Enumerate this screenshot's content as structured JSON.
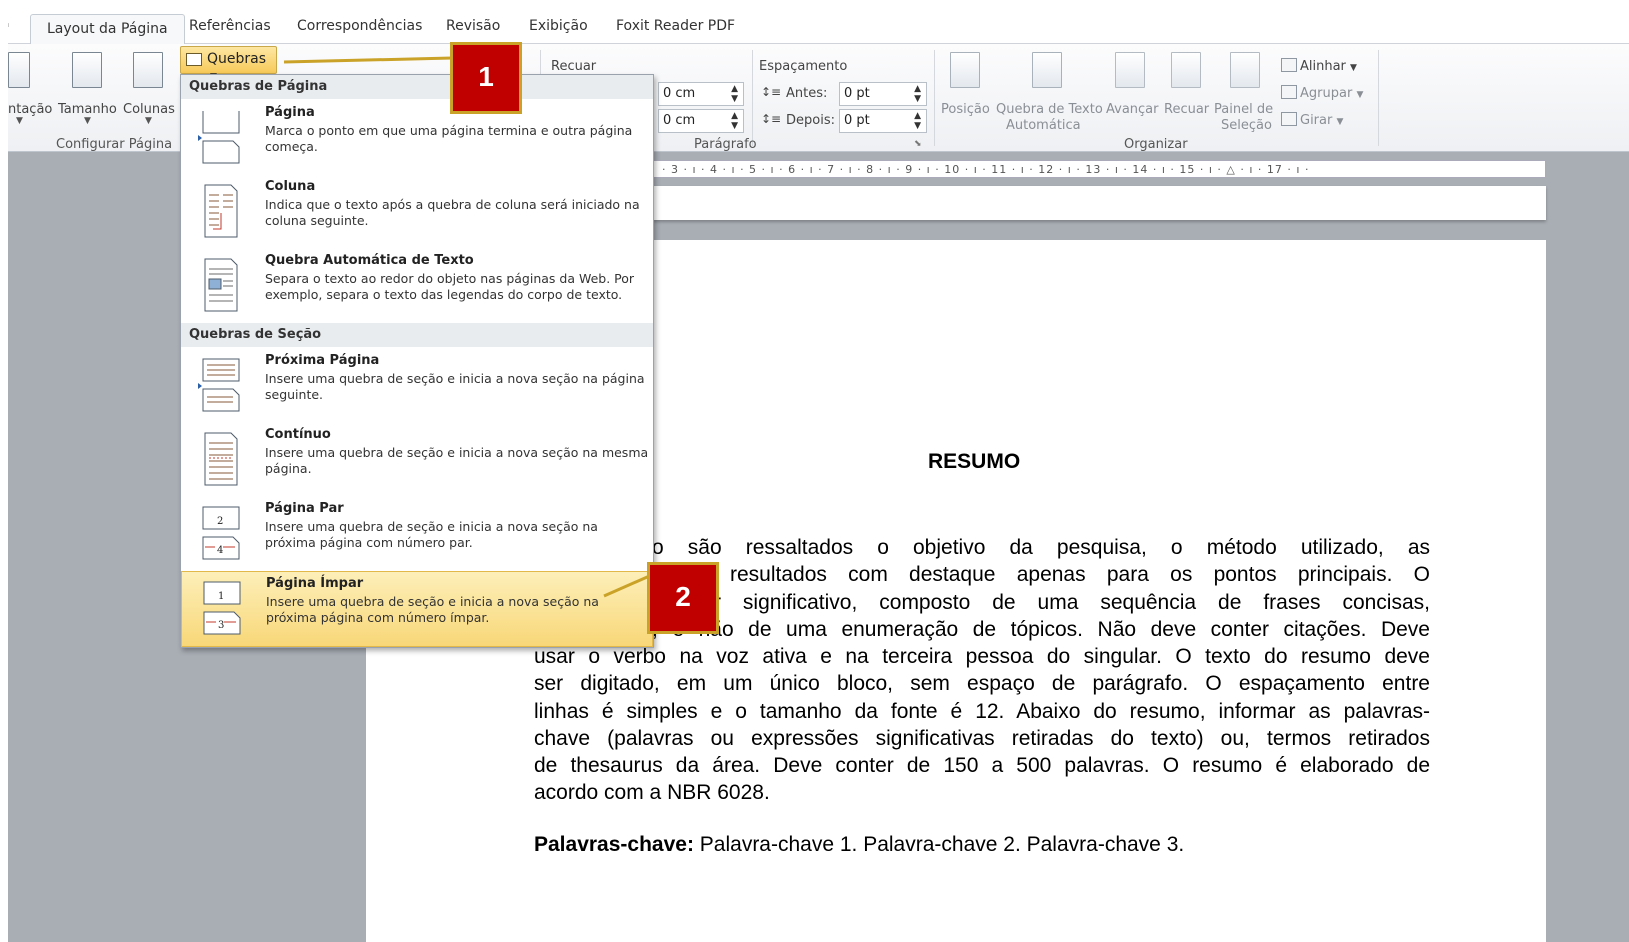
{
  "tabs": [
    "Layout da Página",
    "Referências",
    "Correspondências",
    "Revisão",
    "Exibição",
    "Foxit Reader PDF"
  ],
  "ribbon": {
    "orientacao": "ntação",
    "tamanho": "Tamanho",
    "colunas": "Colunas",
    "configurar_pagina": "Configurar Página",
    "quebras": "Quebras",
    "recuar": "Recuar",
    "espacamento": "Espaçamento",
    "indent_left": "0 cm",
    "indent_right": "0 cm",
    "antes_label": "Antes:",
    "antes_value": "0 pt",
    "depois_label": "Depois:",
    "depois_value": "0 pt",
    "paragrafo": "Parágrafo",
    "posicao": "Posição",
    "quebra_texto_1": "Quebra de Texto",
    "quebra_texto_2": "Automática",
    "avancar": "Avançar",
    "recuar2": "Recuar",
    "painel_1": "Painel de",
    "painel_2": "Seleção",
    "alinhar": "Alinhar",
    "agrupar": "Agrupar",
    "girar": "Girar",
    "organizar": "Organizar"
  },
  "ruler_text": "· 3 · ı · 4 · ı · 5 · ı · 6 · ı · 7 · ı · 8 · ı · 9 · ı · 10 · ı · 11 · ı · 12 · ı · 13 · ı · 14 · ı · 15 · ı · △ · ı · 17 · ı ·",
  "dropdown": {
    "section1": "Quebras de Página",
    "section2": "Quebras de Seção",
    "items": [
      {
        "title": "Página",
        "desc": "Marca o ponto em que uma página termina e outra página começa."
      },
      {
        "title": "Coluna",
        "desc": "Indica que o texto após a quebra de coluna será iniciado na coluna seguinte."
      },
      {
        "title": "Quebra Automática de Texto",
        "desc": "Separa o texto ao redor do objeto nas páginas da Web. Por exemplo, separa o texto das legendas do corpo de texto."
      },
      {
        "title": "Próxima Página",
        "desc": "Insere uma quebra de seção e inicia a nova seção na página seguinte."
      },
      {
        "title": "Contínuo",
        "desc": "Insere uma quebra de seção e inicia a nova seção na mesma página."
      },
      {
        "title": "Página Par",
        "desc": "Insere uma quebra de seção e inicia a nova seção na próxima página com número par."
      },
      {
        "title": "Página Ímpar",
        "desc": "Insere uma quebra de seção e inicia a nova seção na próxima página com número ímpar."
      }
    ]
  },
  "callouts": {
    "one": "1",
    "two": "2"
  },
  "document": {
    "title": "RESUMO",
    "lines": [
      "o são ressaltados o objetivo da pesquisa, o método utilizado, as",
      "resultados com destaque apenas para os pontos principais. O",
      "r significativo, composto de uma sequência de frases concisas,",
      ", e não de uma enumeração de tópicos. Não deve conter citações. Deve",
      "usar o verbo na voz ativa e na terceira pessoa do singular. O texto do resumo deve",
      "ser digitado, em um único bloco, sem espaço de parágrafo. O espaçamento entre",
      "linhas é simples e o tamanho da fonte é 12. Abaixo do resumo, informar as palavras-",
      "chave (palavras ou expressões significativas retiradas do texto) ou, termos retirados",
      "de thesaurus da área. Deve conter de 150 a 500 palavras. O resumo é elaborado de",
      "acordo com a NBR 6028."
    ],
    "keywords_label": "Palavras-chave:",
    "keywords_value": " Palavra-chave 1. Palavra-chave 2. Palavra-chave 3."
  }
}
